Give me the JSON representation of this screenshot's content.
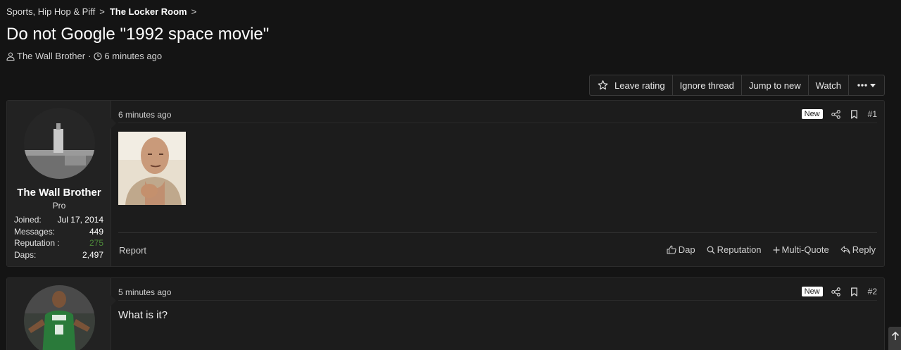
{
  "breadcrumb": {
    "items": [
      "Sports, Hip Hop & Piff",
      "The Locker Room"
    ],
    "separator": ">"
  },
  "thread": {
    "title": "Do not Google \"1992 space movie\"",
    "author": "The Wall Brother",
    "meta_separator": "·",
    "time": "6 minutes ago"
  },
  "actions": {
    "leave_rating": "Leave rating",
    "ignore_thread": "Ignore thread",
    "jump_to_new": "Jump to new",
    "watch": "Watch",
    "more_icon": "ellipsis-dropdown-icon"
  },
  "posts": [
    {
      "username": "The Wall Brother",
      "user_title": "Pro",
      "stats": [
        {
          "label": "Joined:",
          "value": "Jul 17, 2014"
        },
        {
          "label": "Messages:",
          "value": "449"
        },
        {
          "label": "Reputation :",
          "value": "275"
        },
        {
          "label": "Daps:",
          "value": "2,497"
        }
      ],
      "date": "6 minutes ago",
      "badge": "New",
      "number": "#1",
      "footer": {
        "report": "Report",
        "dap": "Dap",
        "reputation": "Reputation",
        "multi_quote": "Multi-Quote",
        "reply": "Reply"
      }
    },
    {
      "date": "5 minutes ago",
      "badge": "New",
      "number": "#2",
      "text": "What is it?"
    }
  ],
  "colors": {
    "background": "#141414",
    "post_bg": "#1c1c1c",
    "reputation_green": "#4d8a3a"
  }
}
